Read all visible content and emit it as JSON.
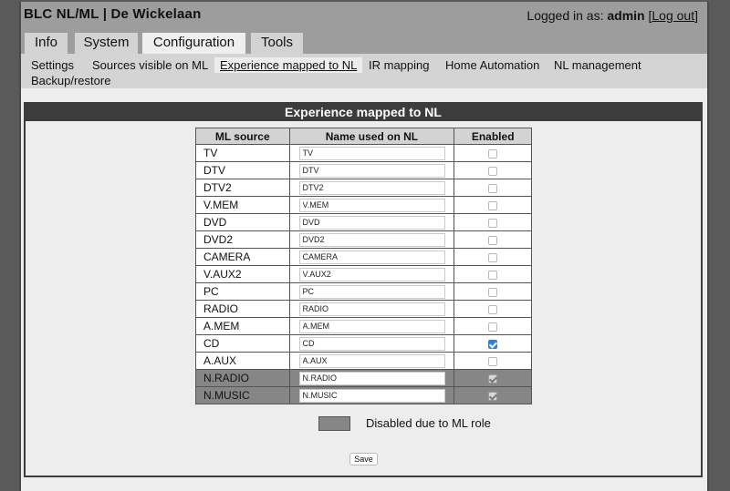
{
  "header": {
    "brand": "BLC NL/ML | De Wickelaan",
    "login_prefix": "Logged in as: ",
    "user": "admin",
    "logout_label": "Log out"
  },
  "main_tabs": [
    {
      "label": "Info"
    },
    {
      "label": "System"
    },
    {
      "label": "Configuration",
      "active": true
    },
    {
      "label": "Tools"
    }
  ],
  "subnav": [
    {
      "label": "Settings"
    },
    {
      "label": "Sources visible on ML"
    },
    {
      "label": "Experience mapped to NL",
      "active": true
    },
    {
      "label": "IR mapping"
    },
    {
      "label": "Home Automation"
    },
    {
      "label": "NL management"
    },
    {
      "label": "Backup/restore"
    }
  ],
  "panel": {
    "title": "Experience mapped to NL",
    "columns": [
      "ML source",
      "Name used on NL",
      "Enabled"
    ],
    "rows": [
      {
        "source": "TV",
        "name": "TV",
        "enabled": false,
        "disabled": false
      },
      {
        "source": "DTV",
        "name": "DTV",
        "enabled": false,
        "disabled": false
      },
      {
        "source": "DTV2",
        "name": "DTV2",
        "enabled": false,
        "disabled": false
      },
      {
        "source": "V.MEM",
        "name": "V.MEM",
        "enabled": false,
        "disabled": false
      },
      {
        "source": "DVD",
        "name": "DVD",
        "enabled": false,
        "disabled": false
      },
      {
        "source": "DVD2",
        "name": "DVD2",
        "enabled": false,
        "disabled": false
      },
      {
        "source": "CAMERA",
        "name": "CAMERA",
        "enabled": false,
        "disabled": false
      },
      {
        "source": "V.AUX2",
        "name": "V.AUX2",
        "enabled": false,
        "disabled": false
      },
      {
        "source": "PC",
        "name": "PC",
        "enabled": false,
        "disabled": false
      },
      {
        "source": "RADIO",
        "name": "RADIO",
        "enabled": false,
        "disabled": false
      },
      {
        "source": "A.MEM",
        "name": "A.MEM",
        "enabled": false,
        "disabled": false
      },
      {
        "source": "CD",
        "name": "CD",
        "enabled": true,
        "disabled": false
      },
      {
        "source": "A.AUX",
        "name": "A.AUX",
        "enabled": false,
        "disabled": false
      },
      {
        "source": "N.RADIO",
        "name": "N.RADIO",
        "enabled": true,
        "disabled": true
      },
      {
        "source": "N.MUSIC",
        "name": "N.MUSIC",
        "enabled": true,
        "disabled": true
      }
    ],
    "legend_label": "Disabled due to ML role",
    "legend_color": "#868686",
    "save_label": "Save"
  },
  "colors": {
    "background": "#5a5a5a",
    "header": "#9d9d9d",
    "panel_title": "#3c3c3c",
    "checkbox_checked": "#2f7fe0"
  }
}
